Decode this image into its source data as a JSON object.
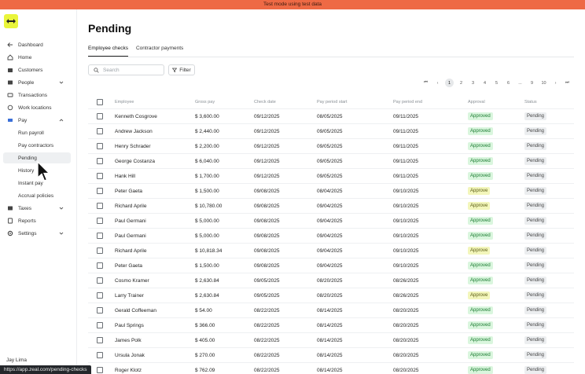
{
  "banner": {
    "text": "Test mode using test data"
  },
  "sidebar": {
    "items": [
      {
        "label": "Dashboard",
        "icon": "arrow-left-icon"
      },
      {
        "label": "Home",
        "icon": "home-icon"
      },
      {
        "label": "Customers",
        "icon": "customers-icon"
      },
      {
        "label": "People",
        "icon": "people-icon"
      },
      {
        "label": "Transactions",
        "icon": "transactions-icon"
      },
      {
        "label": "Work locations",
        "icon": "location-icon"
      },
      {
        "label": "Pay",
        "icon": "pay-icon"
      },
      {
        "label": "Run payroll"
      },
      {
        "label": "Pay contractors"
      },
      {
        "label": "Pending"
      },
      {
        "label": "History"
      },
      {
        "label": "Instant pay"
      },
      {
        "label": "Accrual policies"
      },
      {
        "label": "Taxes",
        "icon": "taxes-icon"
      },
      {
        "label": "Reports",
        "icon": "reports-icon"
      },
      {
        "label": "Settings",
        "icon": "gear-icon"
      }
    ],
    "user": "Jay Lima"
  },
  "status_url": "https://app.zeal.com/pending-checks",
  "page": {
    "title": "Pending",
    "tabs": [
      "Employee checks",
      "Contractor payments"
    ],
    "search_placeholder": "Search",
    "filter_label": "Filter"
  },
  "pagination": {
    "pages": [
      "1",
      "2",
      "3",
      "4",
      "5",
      "6",
      "...",
      "9",
      "10"
    ],
    "active": "1"
  },
  "table": {
    "columns": [
      "Employee",
      "Gross pay",
      "Check date",
      "Pay period start",
      "Pay period end",
      "Approval",
      "Status"
    ],
    "rows": [
      {
        "employee": "Kenneth Cosgrove",
        "gross": "$ 3,600.00",
        "check_date": "09/12/2025",
        "start": "08/05/2025",
        "end": "09/11/2025",
        "approval": "Approved",
        "status": "Pending"
      },
      {
        "employee": "Andrew Jackson",
        "gross": "$ 2,440.00",
        "check_date": "09/12/2025",
        "start": "09/05/2025",
        "end": "09/11/2025",
        "approval": "Approved",
        "status": "Pending"
      },
      {
        "employee": "Henry Schrader",
        "gross": "$ 2,200.00",
        "check_date": "09/12/2025",
        "start": "09/05/2025",
        "end": "09/11/2025",
        "approval": "Approved",
        "status": "Pending"
      },
      {
        "employee": "George Costanza",
        "gross": "$ 6,040.00",
        "check_date": "09/12/2025",
        "start": "09/05/2025",
        "end": "09/11/2025",
        "approval": "Approved",
        "status": "Pending"
      },
      {
        "employee": "Hank Hill",
        "gross": "$ 1,700.00",
        "check_date": "09/12/2025",
        "start": "09/05/2025",
        "end": "09/11/2025",
        "approval": "Approved",
        "status": "Pending"
      },
      {
        "employee": "Peter Gaeta",
        "gross": "$ 1,500.00",
        "check_date": "09/08/2025",
        "start": "08/04/2025",
        "end": "09/10/2025",
        "approval": "Approve",
        "status": "Pending"
      },
      {
        "employee": "Richard Aprile",
        "gross": "$ 10,780.00",
        "check_date": "09/08/2025",
        "start": "09/04/2025",
        "end": "09/10/2025",
        "approval": "Approve",
        "status": "Pending"
      },
      {
        "employee": "Paul Germani",
        "gross": "$ 5,000.00",
        "check_date": "09/08/2025",
        "start": "09/04/2025",
        "end": "09/10/2025",
        "approval": "Approved",
        "status": "Pending"
      },
      {
        "employee": "Paul Germani",
        "gross": "$ 5,000.00",
        "check_date": "09/08/2025",
        "start": "09/04/2025",
        "end": "09/10/2025",
        "approval": "Approved",
        "status": "Pending"
      },
      {
        "employee": "Richard Aprile",
        "gross": "$ 10,818.34",
        "check_date": "09/08/2025",
        "start": "09/04/2025",
        "end": "09/10/2025",
        "approval": "Approve",
        "status": "Pending"
      },
      {
        "employee": "Peter Gaeta",
        "gross": "$ 1,500.00",
        "check_date": "09/08/2025",
        "start": "09/04/2025",
        "end": "09/10/2025",
        "approval": "Approved",
        "status": "Pending"
      },
      {
        "employee": "Cosmo Kramer",
        "gross": "$ 2,630.84",
        "check_date": "09/05/2025",
        "start": "08/20/2025",
        "end": "08/26/2025",
        "approval": "Approved",
        "status": "Pending"
      },
      {
        "employee": "Larry Trainer",
        "gross": "$ 2,630.84",
        "check_date": "09/05/2025",
        "start": "08/20/2025",
        "end": "08/26/2025",
        "approval": "Approve",
        "status": "Pending"
      },
      {
        "employee": "Gerald Coffeeman",
        "gross": "$ 54.00",
        "check_date": "08/22/2025",
        "start": "08/14/2025",
        "end": "08/20/2025",
        "approval": "Approved",
        "status": "Pending"
      },
      {
        "employee": "Paul Springs",
        "gross": "$ 366.00",
        "check_date": "08/22/2025",
        "start": "08/14/2025",
        "end": "08/20/2025",
        "approval": "Approved",
        "status": "Pending"
      },
      {
        "employee": "James Polk",
        "gross": "$ 405.00",
        "check_date": "08/22/2025",
        "start": "08/14/2025",
        "end": "08/20/2025",
        "approval": "Approved",
        "status": "Pending"
      },
      {
        "employee": "Ursula Jonak",
        "gross": "$ 270.00",
        "check_date": "08/22/2025",
        "start": "08/14/2025",
        "end": "08/20/2025",
        "approval": "Approved",
        "status": "Pending"
      },
      {
        "employee": "Roger Klotz",
        "gross": "$ 762.09",
        "check_date": "08/22/2025",
        "start": "08/14/2025",
        "end": "08/20/2025",
        "approval": "Approved",
        "status": "Pending"
      }
    ]
  },
  "colors": {
    "banner": "#ee6a45",
    "logo": "#e9f53a",
    "approved": "#daf6de",
    "approve": "#f3f6bb",
    "pending": "#eceef0"
  }
}
